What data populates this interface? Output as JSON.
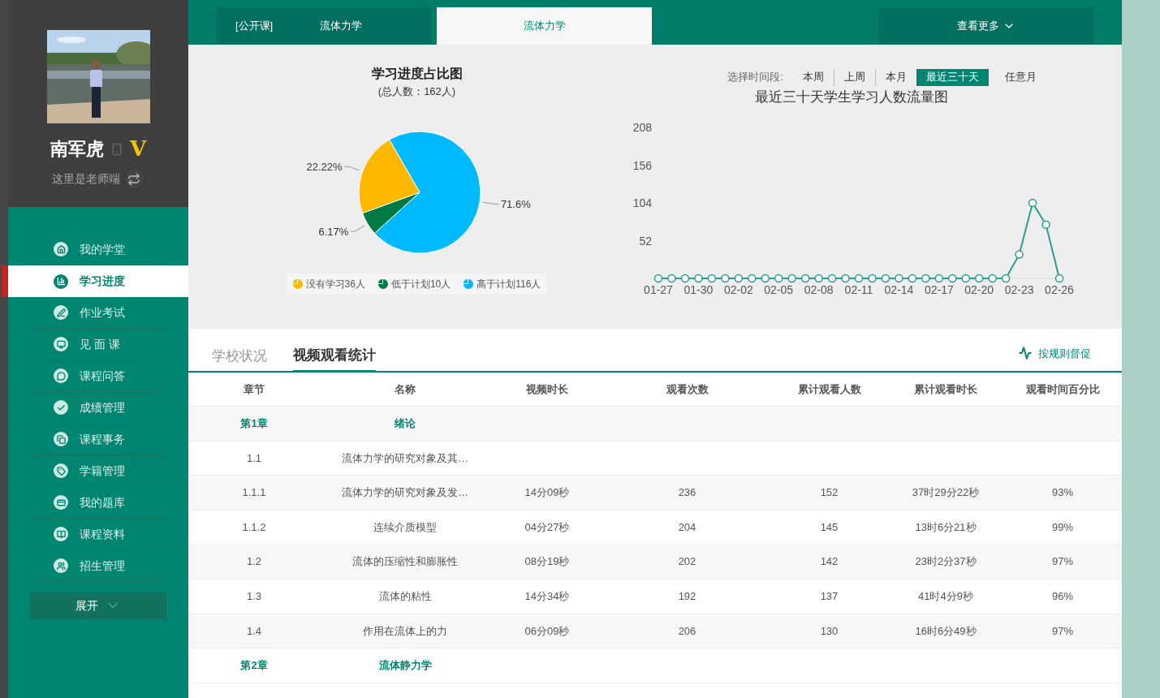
{
  "profile": {
    "name": "南军虎",
    "badge": "V",
    "role": "这里是老师端"
  },
  "nav": {
    "items": [
      {
        "label": "我的学堂",
        "selected": false
      },
      {
        "label": "学习进度",
        "selected": true
      },
      {
        "label": "作业考试",
        "selected": false
      },
      {
        "label": "见 面 课",
        "selected": false
      },
      {
        "label": "课程问答",
        "selected": false
      },
      {
        "label": "成绩管理",
        "selected": false
      },
      {
        "label": "课程事务",
        "selected": false
      },
      {
        "label": "学籍管理",
        "selected": false
      },
      {
        "label": "我的题库",
        "selected": false
      },
      {
        "label": "课程资料",
        "selected": false
      },
      {
        "label": "招生管理",
        "selected": false
      }
    ],
    "expand": "展开"
  },
  "course_tabs": [
    {
      "label": "[公开课]",
      "selected": false
    },
    {
      "label": "流体力学",
      "selected": false
    },
    {
      "label": "流体力学",
      "selected": true
    }
  ],
  "more": "查看更多",
  "pie": {
    "subtitle": "(总人数：162人)",
    "chart_data": {
      "type": "pie",
      "title": "学习进度占比图",
      "legend": "bottom",
      "categories": [
        "没有学习36人",
        "低于计划10人",
        "高于计划116人"
      ],
      "values": [
        22.22,
        6.17,
        71.6
      ],
      "colors": [
        "#ffb800",
        "#007a45",
        "#00baff"
      ],
      "value_labels": [
        "22.22%",
        "6.17%",
        "71.6%"
      ]
    }
  },
  "period": {
    "label": "选择时间段:",
    "options": [
      {
        "label": "本周",
        "selected": false
      },
      {
        "label": "上周",
        "selected": false
      },
      {
        "label": "本月",
        "selected": false
      },
      {
        "label": "最近三十天",
        "selected": true
      },
      {
        "label": "任意月",
        "selected": false
      }
    ]
  },
  "line": {
    "chart_data": {
      "type": "line",
      "title": "最近三十天学生学习人数流量图",
      "categories": [
        "01-27",
        null,
        null,
        "01-30",
        null,
        null,
        "02-02",
        null,
        null,
        "02-05",
        null,
        null,
        "02-08",
        null,
        null,
        "02-11",
        null,
        null,
        "02-14",
        null,
        null,
        "02-17",
        null,
        null,
        "02-20",
        null,
        null,
        "02-23",
        null,
        null,
        "02-26"
      ],
      "series": [
        {
          "color": "#2a9d8f",
          "marker": "circle",
          "values": [
            0,
            0,
            0,
            0,
            0,
            0,
            0,
            0,
            0,
            0,
            0,
            0,
            0,
            0,
            0,
            0,
            0,
            0,
            0,
            0,
            0,
            0,
            0,
            0,
            0,
            0,
            0,
            33,
            104,
            74,
            0
          ]
        }
      ],
      "ylim": [
        0,
        208
      ],
      "yticks": [
        52,
        104,
        156,
        208
      ]
    }
  },
  "section_tabs": [
    {
      "label": "学校状况",
      "selected": false
    },
    {
      "label": "视频观看统计",
      "selected": true
    }
  ],
  "remind": "按规则督促",
  "table": {
    "columns": [
      "章节",
      "名称",
      "视频时长",
      "观看次数",
      "累计观看人数",
      "累计观看时长",
      "观看时间百分比"
    ],
    "rows": [
      {
        "kind": "chapter",
        "cells": [
          "第1章",
          "绪论"
        ]
      },
      {
        "kind": "section",
        "cells": [
          "1.1",
          "流体力学的研究对象及其…"
        ]
      },
      {
        "kind": "section",
        "cells": [
          "1.1.1",
          "流体力学的研究对象及发…",
          "14分09秒",
          "236",
          "152",
          "37时29分22秒",
          "93%"
        ]
      },
      {
        "kind": "section",
        "cells": [
          "1.1.2",
          "连续介质模型",
          "04分27秒",
          "204",
          "145",
          "13时6分21秒",
          "99%"
        ]
      },
      {
        "kind": "section",
        "cells": [
          "1.2",
          "流体的压缩性和膨胀性",
          "08分19秒",
          "202",
          "142",
          "23时2分37秒",
          "97%"
        ]
      },
      {
        "kind": "section",
        "cells": [
          "1.3",
          "流体的粘性",
          "14分34秒",
          "192",
          "137",
          "41时4分9秒",
          "96%"
        ]
      },
      {
        "kind": "section",
        "cells": [
          "1.4",
          "作用在流体上的力",
          "06分09秒",
          "206",
          "130",
          "16时6分49秒",
          "97%"
        ]
      },
      {
        "kind": "chapter",
        "cells": [
          "第2章",
          "流体静力学"
        ]
      }
    ]
  }
}
